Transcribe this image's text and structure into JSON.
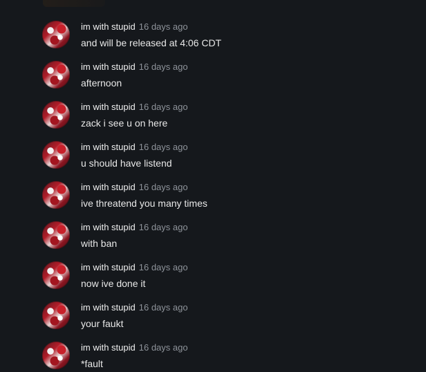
{
  "messages": [
    {
      "author": "im with stupid",
      "time": "16 days ago",
      "text": "and will be released at 4:06 CDT"
    },
    {
      "author": "im with stupid",
      "time": "16 days ago",
      "text": "afternoon"
    },
    {
      "author": "im with stupid",
      "time": "16 days ago",
      "text": "zack i see u on here"
    },
    {
      "author": "im with stupid",
      "time": "16 days ago",
      "text": "u should have listend"
    },
    {
      "author": "im with stupid",
      "time": "16 days ago",
      "text": "ive threatend you many times"
    },
    {
      "author": "im with stupid",
      "time": "16 days ago",
      "text": "with ban"
    },
    {
      "author": "im with stupid",
      "time": "16 days ago",
      "text": "now ive done it"
    },
    {
      "author": "im with stupid",
      "time": "16 days ago",
      "text": "your faukt"
    },
    {
      "author": "im with stupid",
      "time": "16 days ago",
      "text": "*fault"
    }
  ]
}
